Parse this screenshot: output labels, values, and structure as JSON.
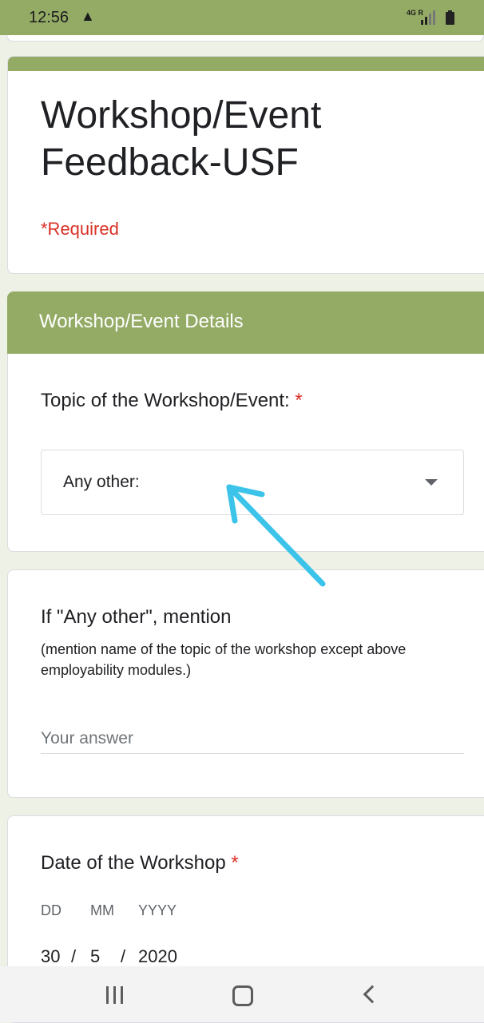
{
  "status_bar": {
    "time": "12:56",
    "warning_icon": "warning-triangle-icon",
    "network": "4G",
    "roaming": "R",
    "signal_icon": "cell-signal-icon",
    "battery_icon": "battery-icon"
  },
  "form": {
    "title": "Workshop/Event Feedback-USF",
    "required_note": "*Required",
    "accent_color": "#94ab66",
    "required_color": "#d93025"
  },
  "section": {
    "title": "Workshop/Event Details"
  },
  "topic_question": {
    "label": "Topic of the Workshop/Event:",
    "required_mark": "*",
    "selected_value": "Any other:",
    "dropdown_icon": "caret-down-icon"
  },
  "other_question": {
    "label": "If \"Any other\", mention",
    "description": "(mention name of the topic of the workshop except above employability modules.)",
    "placeholder": "Your answer"
  },
  "date_question": {
    "label": "Date of the Workshop",
    "required_mark": "*",
    "field_labels": {
      "day": "DD",
      "month": "MM",
      "year": "YYYY"
    },
    "values": {
      "day": "30",
      "month": "5",
      "year": "2020"
    },
    "separator": "/"
  },
  "annotation": {
    "arrow_color": "#3cc3ea",
    "arrow_icon": "pointer-arrow-icon"
  },
  "nav_bar": {
    "recents_icon": "recents-icon",
    "home_icon": "home-icon",
    "back_icon": "back-icon"
  }
}
